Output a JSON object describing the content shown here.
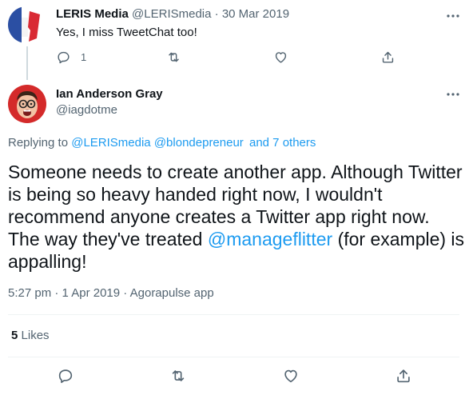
{
  "reply_tweet": {
    "author_name": "LERIS Media",
    "author_handle": "@LERISmedia",
    "separator": "·",
    "date": "30 Mar 2019",
    "text": "Yes, I miss TweetChat too!",
    "reply_count": "1",
    "avatar_colors": {
      "blue": "#2b4fa3",
      "white": "#ffffff",
      "red": "#d92a34"
    }
  },
  "main_tweet": {
    "author_name": "Ian Anderson Gray",
    "author_handle": "@iagdotme",
    "replying_prefix": "Replying to",
    "replying_to": [
      "@LERISmedia",
      "@blondepreneur"
    ],
    "replying_others": "and 7 others",
    "body_before": "Someone needs to create another app. Although Twitter is being so heavy handed right now, I wouldn't recommend anyone creates a Twitter app right now. The way they've treated",
    "body_mention": "@manageflitter",
    "body_after": "(for example) is appalling!",
    "time": "5:27 pm",
    "separator": "·",
    "date": "1 Apr 2019",
    "source": "Agorapulse app",
    "likes_count": "5",
    "likes_label": "Likes"
  },
  "icons": {
    "more": "more-icon",
    "reply": "reply-icon",
    "retweet": "retweet-icon",
    "like": "like-icon",
    "share": "share-icon"
  },
  "colors": {
    "text_primary": "#0f1419",
    "text_secondary": "#536471",
    "link": "#1d9bf0",
    "divider": "#eff3f4"
  }
}
